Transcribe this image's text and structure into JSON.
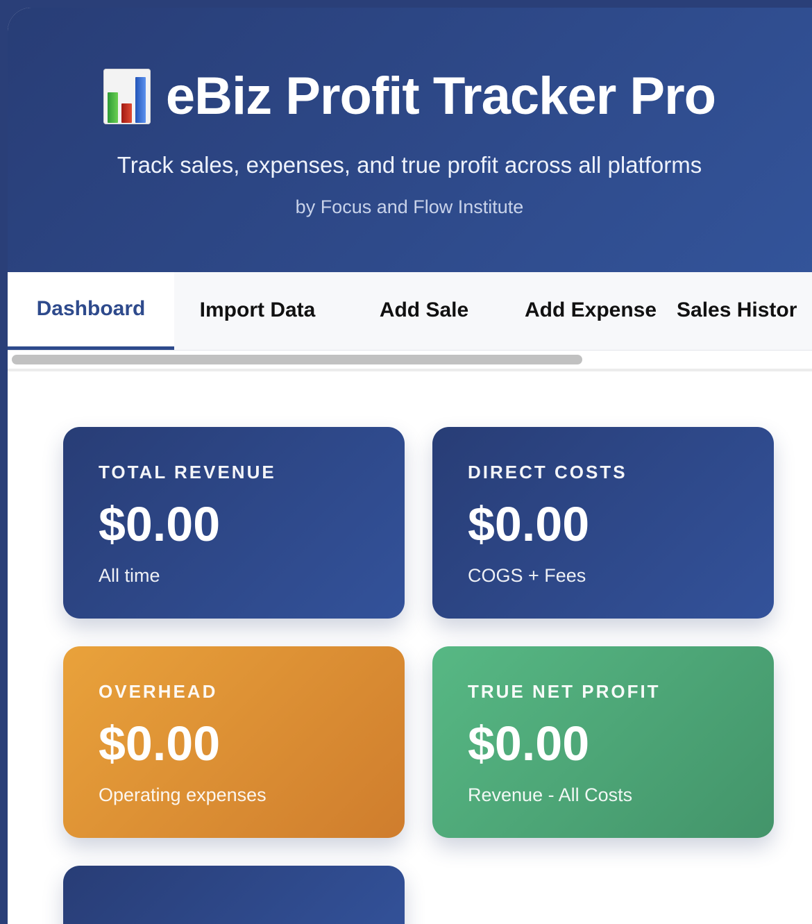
{
  "header": {
    "title": "eBiz Profit Tracker Pro",
    "icon": "bar-chart-icon",
    "subtitle": "Track sales, expenses, and true profit across all platforms",
    "byline": "by Focus and Flow Institute"
  },
  "tabs": [
    {
      "label": "Dashboard",
      "active": true
    },
    {
      "label": "Import Data",
      "active": false
    },
    {
      "label": "Add Sale",
      "active": false
    },
    {
      "label": "Add Expense",
      "active": false
    },
    {
      "label": "Sales Histor",
      "active": false
    }
  ],
  "cards": [
    {
      "label": "TOTAL REVENUE",
      "value": "$0.00",
      "sub": "All time",
      "color": "#2e4a8c"
    },
    {
      "label": "DIRECT COSTS",
      "value": "$0.00",
      "sub": "COGS + Fees",
      "color": "#2e4a8c"
    },
    {
      "label": "OVERHEAD",
      "value": "$0.00",
      "sub": "Operating expenses",
      "color": "#e0923a"
    },
    {
      "label": "TRUE NET PROFIT",
      "value": "$0.00",
      "sub": "Revenue - All Costs",
      "color": "#4fa878"
    }
  ],
  "colors": {
    "brand": "#2e4a8c",
    "background": "#2a3f78"
  }
}
